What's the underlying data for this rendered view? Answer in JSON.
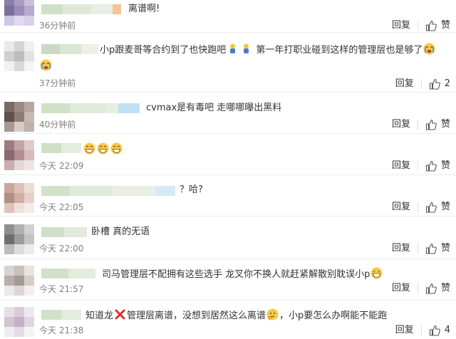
{
  "comments": [
    {
      "text": "离谱啊!",
      "time": "36分钟前",
      "reply": "回复",
      "likes": "赞"
    },
    {
      "text": "小p跟麦哥等合约到了也快跑吧",
      "text2": "第一年打职业碰到这样的管理层也是够了",
      "time": "37分钟前",
      "reply": "回复",
      "likes": "2"
    },
    {
      "text": "cvmax是有毒吧 走哪哪曝出黑料",
      "time": "40分钟前",
      "reply": "回复",
      "likes": "赞"
    },
    {
      "text": "",
      "time": "今天 22:09",
      "reply": "回复",
      "likes": "赞"
    },
    {
      "text": "？哈?",
      "time": "今天 22:05",
      "reply": "回复",
      "likes": "赞"
    },
    {
      "text": "卧槽 真的无语",
      "time": "今天 22:00",
      "reply": "回复",
      "likes": "赞"
    },
    {
      "text": "司马管理层不配拥有这些选手 龙叉你不换人就赶紧解散别耽误小p",
      "time": "今天 21:57",
      "reply": "回复",
      "likes": "赞"
    },
    {
      "text": "知道龙",
      "text2": "管理层离谱，没想到居然这么离谱",
      "text3": "，小p要怎么办啊能不能跑",
      "time": "今天 21:38",
      "reply": "回复",
      "likes": "4"
    }
  ],
  "colors": {
    "text": "#333333",
    "meta": "#808080",
    "divider": "#ececec"
  }
}
